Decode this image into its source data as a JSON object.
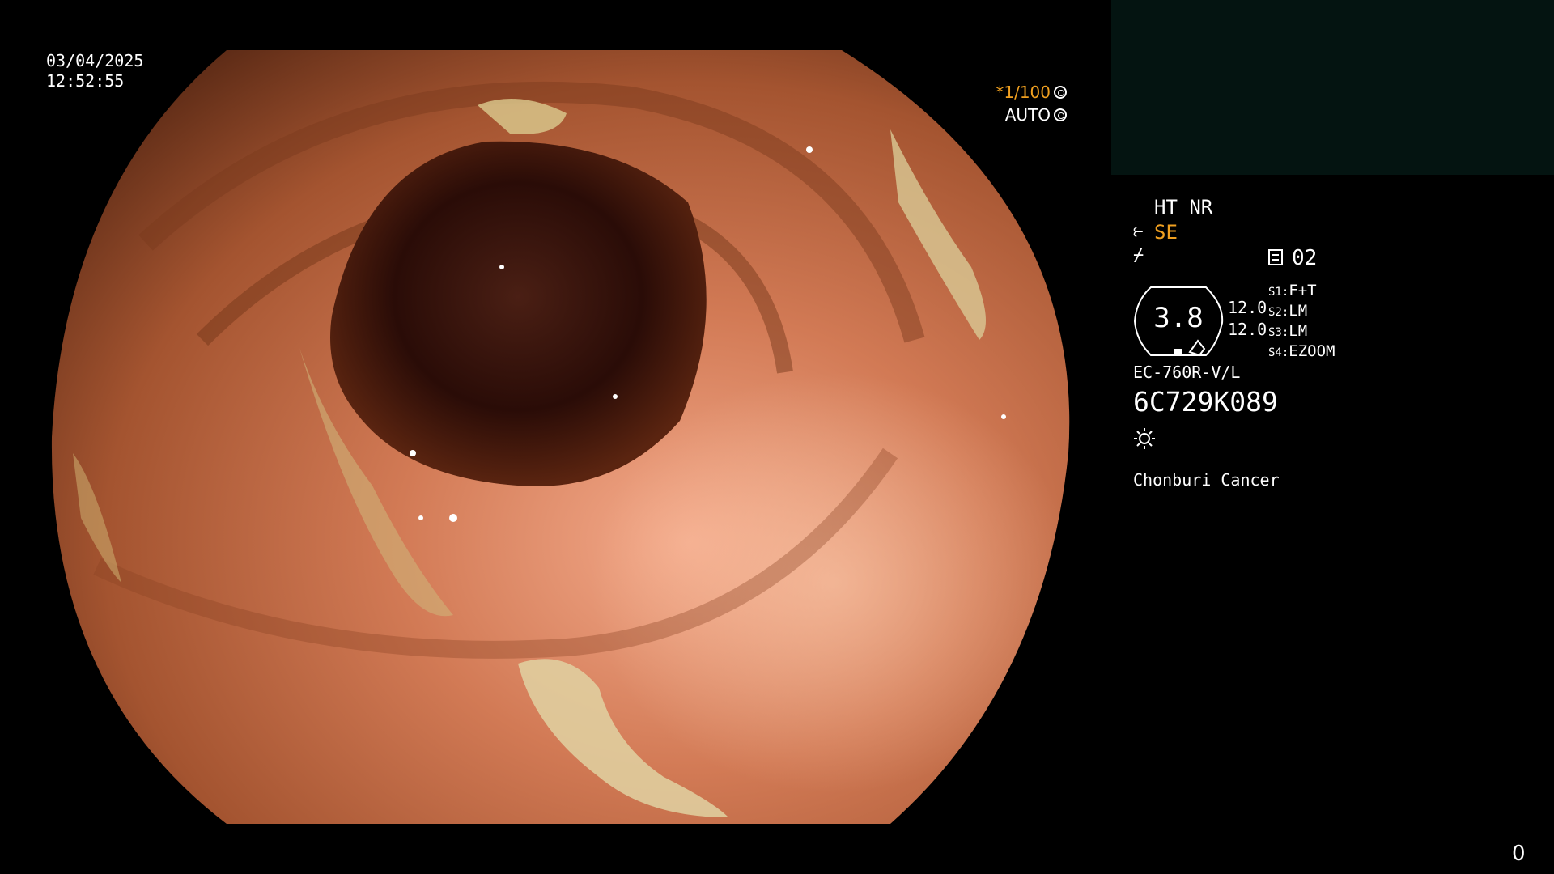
{
  "overlay": {
    "date": "03/04/2025",
    "time": "12:52:55",
    "shutter_speed": "*1/100",
    "shutter_speed_icon": "aperture-icon",
    "iris_mode": "AUTO",
    "iris_mode_icon": "iris-icon"
  },
  "panel": {
    "image_mode": "HT NR",
    "structure_enhancement": "SE",
    "structure_enhancement_icon": "structure-enhancement-icon",
    "color_enhancement_icon": "color-enhancement-icon",
    "memory_icon": "memory-icon",
    "memory_slot": "02",
    "magnification": "3.8",
    "rate_1": "12.0",
    "rate_2": "12.0",
    "switches": [
      {
        "key": "S1",
        "value": "F+T"
      },
      {
        "key": "S2",
        "value": "LM"
      },
      {
        "key": "S3",
        "value": "LM"
      },
      {
        "key": "S4",
        "value": "EZOOM"
      }
    ],
    "scope_model": "EC-760R-V/L",
    "scope_serial": "6C729K089",
    "light_icon": "light-source-icon",
    "institution": "Chonburi Cancer"
  },
  "footer": {
    "counter": "0"
  },
  "colors": {
    "background": "#000000",
    "pip_background": "#041411",
    "highlight": "#f0a020",
    "text": "#ffffff"
  }
}
